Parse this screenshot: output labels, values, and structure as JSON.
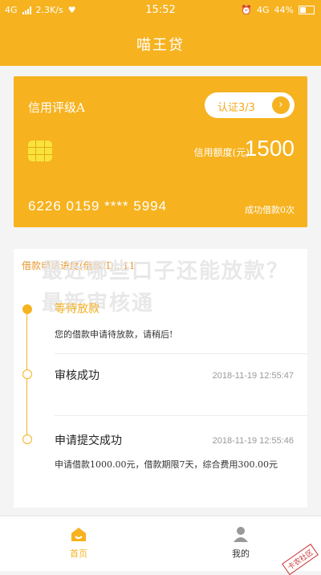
{
  "status_bar": {
    "network": "4G",
    "speed": "2.3K/s",
    "time": "15:52",
    "network_right": "4G",
    "battery": "44%",
    "battery_level": 0.44
  },
  "header": {
    "title": "喵王贷"
  },
  "card": {
    "rating": "信用评级A",
    "cert_label": "认证3/3",
    "limit_label": "信用额度(元)",
    "limit_value": "1500",
    "card_number": "6226 0159 **** 5994",
    "loan_count": "成功借款0次"
  },
  "panel": {
    "title": "借款申请进度(借款ID...11",
    "watermark": "最近哪些口子还能放款？最新审核通",
    "steps": [
      {
        "title": "等待放款",
        "desc": "您的借款申请待放款，请稍后!",
        "time": ""
      },
      {
        "title": "审核成功",
        "desc": "",
        "time": "2018-11-19 12:55:47"
      },
      {
        "title": "申请提交成功",
        "desc": "申请借款1000.00元，借款期限7天，综合费用300.00元",
        "time": "2018-11-19 12:55:46"
      }
    ]
  },
  "tabbar": {
    "home": "首页",
    "mine": "我的",
    "corner_badge": "卡农社区"
  },
  "colors": {
    "accent": "#f6b21f"
  }
}
